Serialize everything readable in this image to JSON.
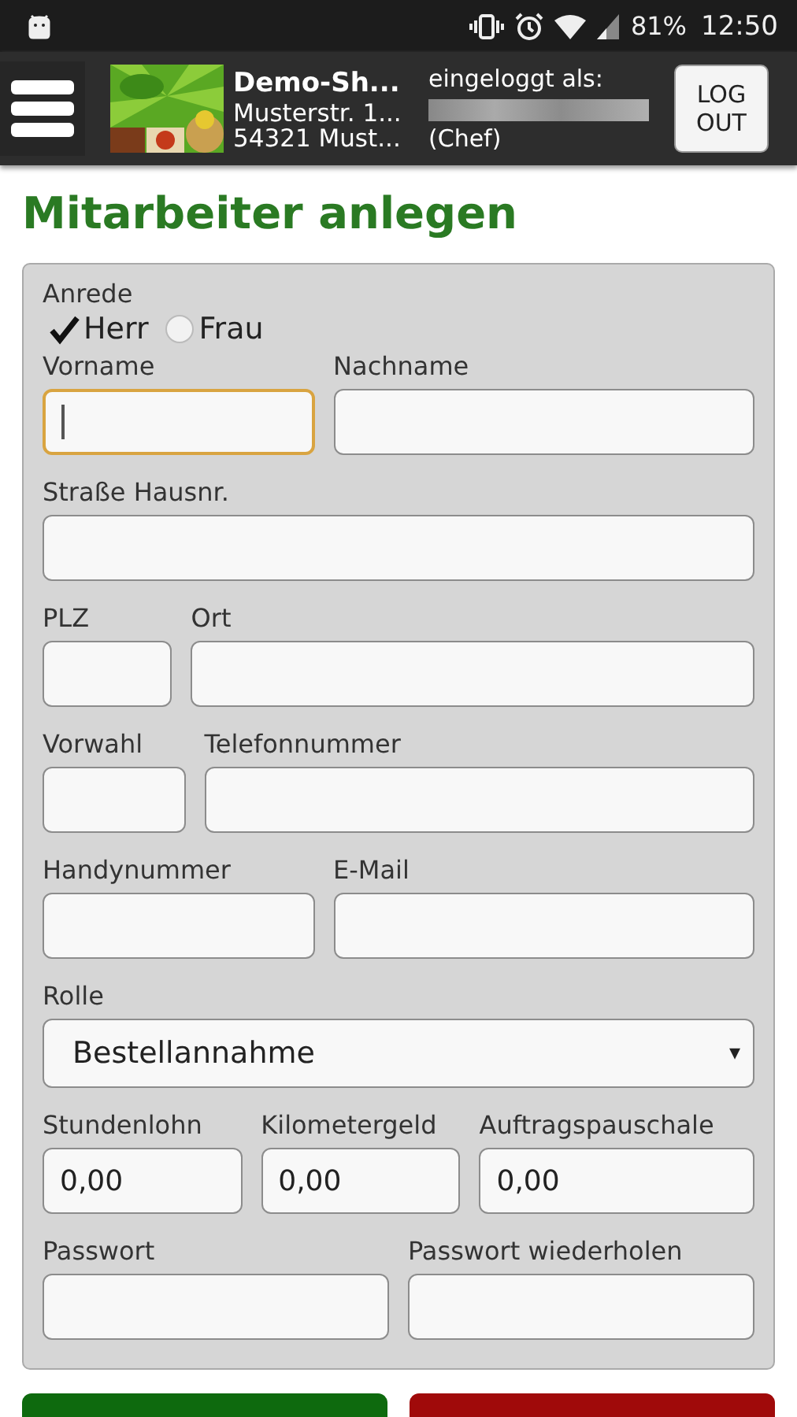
{
  "status_bar": {
    "battery": "81%",
    "time": "12:50"
  },
  "header": {
    "shop_name": "Demo-Sh...",
    "shop_street": "Musterstr. 1...",
    "shop_city": "54321 Must...",
    "login_label": "eingeloggt als:",
    "role": "(Chef)",
    "logout_button": "LOG OUT"
  },
  "page_title": "Mitarbeiter anlegen",
  "form": {
    "salutation": {
      "label": "Anrede",
      "options": [
        {
          "label": "Herr",
          "selected": true
        },
        {
          "label": "Frau",
          "selected": false
        }
      ]
    },
    "rows": [
      {
        "fields": [
          {
            "label": "Vorname",
            "focused": true
          },
          {
            "label": "Nachname",
            "focused": false
          }
        ]
      },
      {
        "fields": [
          {
            "label": "Straße Hausnr.",
            "focused": false
          }
        ]
      },
      {
        "fields": [
          {
            "label": "PLZ",
            "focused": false
          },
          {
            "label": "Ort",
            "focused": false
          }
        ]
      },
      {
        "fields": [
          {
            "label": "Vorwahl",
            "focused": false
          },
          {
            "label": "Telefonnummer",
            "focused": false
          }
        ]
      },
      {
        "fields": [
          {
            "label": "Handynummer",
            "focused": false
          },
          {
            "label": "E-Mail",
            "focused": false
          }
        ]
      },
      {
        "select": {
          "label": "Rolle",
          "value": "Bestellannahme",
          "caret": "▾"
        }
      },
      {
        "fields": [
          {
            "label": "Stundenlohn",
            "value": "0,00",
            "focused": false
          },
          {
            "label": "Kilometergeld",
            "value": "0,00",
            "focused": false
          },
          {
            "label": "Auftragspauschale",
            "value": "0,00",
            "focused": false
          }
        ]
      },
      {
        "fields": [
          {
            "label": "Passwort",
            "focused": false
          },
          {
            "label": "Passwort wiederholen",
            "focused": false
          }
        ]
      }
    ]
  },
  "buttons": [
    {
      "kind": "confirm"
    },
    {
      "kind": "cancel"
    }
  ]
}
